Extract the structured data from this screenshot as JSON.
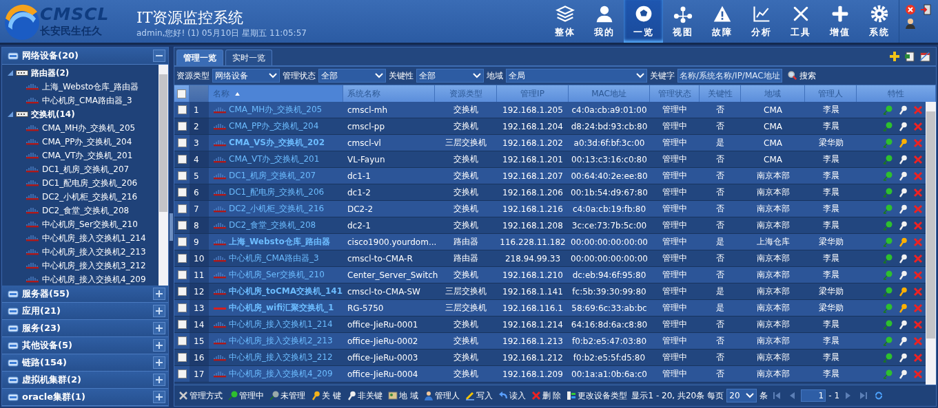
{
  "header": {
    "logo": {
      "name": "CMSCL",
      "slogan": "长安民生任久"
    },
    "title": "IT资源监控系统",
    "status_line": "admin,您好! (1) 05月10日 星期五 11:05:57",
    "nav": [
      {
        "label": "整体",
        "selected": false
      },
      {
        "label": "我的",
        "selected": false
      },
      {
        "label": "一览",
        "selected": true
      },
      {
        "label": "视图",
        "selected": false
      },
      {
        "label": "故障",
        "selected": false
      },
      {
        "label": "分析",
        "selected": false
      },
      {
        "label": "工具",
        "selected": false
      },
      {
        "label": "增值",
        "selected": false
      },
      {
        "label": "系统",
        "selected": false
      }
    ]
  },
  "sidebar": {
    "groups": [
      {
        "label": "网络设备(20)",
        "expanded": true,
        "children": [
          {
            "label": "路由器(2)",
            "expanded": true,
            "children": [
              {
                "label": "上海_Websto仓库_路由器"
              },
              {
                "label": "中心机房_CMA路由器_3"
              }
            ]
          },
          {
            "label": "交换机(14)",
            "expanded": true,
            "children": [
              {
                "label": "CMA_MH办_交换机_205"
              },
              {
                "label": "CMA_PP办_交换机_204"
              },
              {
                "label": "CMA_VT办_交换机_201"
              },
              {
                "label": "DC1_机房_交换机_207"
              },
              {
                "label": "DC1_配电房_交换机_206"
              },
              {
                "label": "DC2_小机柜_交换机_216"
              },
              {
                "label": "DC2_食堂_交换机_208"
              },
              {
                "label": "中心机房_Ser交换机_210"
              },
              {
                "label": "中心机房_接入交换机1_214"
              },
              {
                "label": "中心机房_接入交换机2_213"
              },
              {
                "label": "中心机房_接入交换机3_212"
              },
              {
                "label": "中心机房_接入交换机4_209"
              }
            ]
          }
        ]
      },
      {
        "label": "服务器(55)",
        "expanded": false
      },
      {
        "label": "应用(21)",
        "expanded": false
      },
      {
        "label": "服务(23)",
        "expanded": false
      },
      {
        "label": "其他设备(5)",
        "expanded": false
      },
      {
        "label": "链路(154)",
        "expanded": false
      },
      {
        "label": "虚拟机集群(2)",
        "expanded": false
      },
      {
        "label": "oracle集群(1)",
        "expanded": false
      }
    ]
  },
  "tabs": [
    {
      "label": "管理一览",
      "selected": true
    },
    {
      "label": "实时一览",
      "selected": false
    }
  ],
  "filters": [
    {
      "label": "资源类型",
      "value": "网络设备"
    },
    {
      "label": "管理状态",
      "value": "全部"
    },
    {
      "label": "关键性",
      "value": "全部"
    },
    {
      "label": "地域",
      "value": "全局"
    }
  ],
  "keyword": {
    "label": "关键字",
    "placeholder": "名称/系统名称/IP/MAC地址"
  },
  "search_button": "搜索",
  "table": {
    "select_all_checked": false,
    "columns": [
      {
        "label": "名称",
        "sorted": true
      },
      {
        "label": "系统名称",
        "sorted": false
      },
      {
        "label": "资源类型",
        "sorted": false
      },
      {
        "label": "管理IP",
        "sorted": false
      },
      {
        "label": "MAC地址",
        "sorted": false
      },
      {
        "label": "管理状态",
        "sorted": false
      },
      {
        "label": "关键性",
        "sorted": false
      },
      {
        "label": "地域",
        "sorted": false
      },
      {
        "label": "管理人",
        "sorted": false
      },
      {
        "label": "特性",
        "sorted": false
      }
    ],
    "rows": [
      {
        "checked": false,
        "index": "1",
        "kind": "cisco",
        "name": "CMA_MH办_交换机_205",
        "system_name": "cmscl-mh",
        "type": "交换机",
        "ip": "192.168.1.205",
        "mac": "c4:0a:cb:a9:01:00",
        "status": "管理中",
        "critical": "否",
        "region": "CMA",
        "manager": "李晨",
        "key": false
      },
      {
        "checked": false,
        "index": "2",
        "kind": "cisco",
        "name": "CMA_PP办_交换机_204",
        "system_name": "cmscl-pp",
        "type": "交换机",
        "ip": "192.168.1.204",
        "mac": "d8:24:bd:93:cb:80",
        "status": "管理中",
        "critical": "否",
        "region": "CMA",
        "manager": "李晨",
        "key": false
      },
      {
        "checked": false,
        "index": "3",
        "kind": "cisco",
        "name": "CMA_VS办_交换机_202",
        "system_name": "cmscl-vl",
        "type": "三层交换机",
        "ip": "192.168.1.202",
        "mac": "a0:3d:6f:bf:3c:00",
        "status": "管理中",
        "critical": "是",
        "region": "CMA",
        "manager": "梁华勋",
        "key": true
      },
      {
        "checked": false,
        "index": "4",
        "kind": "cisco",
        "name": "CMA_VT办_交换机_201",
        "system_name": "VL-Fayun",
        "type": "交换机",
        "ip": "192.168.1.201",
        "mac": "00:13:c3:16:c0:80",
        "status": "管理中",
        "critical": "否",
        "region": "CMA",
        "manager": "李晨",
        "key": false
      },
      {
        "checked": false,
        "index": "5",
        "kind": "cisco",
        "name": "DC1_机房_交换机_207",
        "system_name": "dc1-1",
        "type": "交换机",
        "ip": "192.168.1.207",
        "mac": "00:64:40:2e:ee:80",
        "status": "管理中",
        "critical": "否",
        "region": "南京本部",
        "manager": "李晨",
        "key": false
      },
      {
        "checked": false,
        "index": "6",
        "kind": "cisco",
        "name": "DC1_配电房_交换机_206",
        "system_name": "dc1-2",
        "type": "交换机",
        "ip": "192.168.1.206",
        "mac": "00:1b:54:d9:67:80",
        "status": "管理中",
        "critical": "否",
        "region": "南京本部",
        "manager": "李晨",
        "key": false
      },
      {
        "checked": false,
        "index": "7",
        "kind": "cisco",
        "name": "DC2_小机柜_交换机_216",
        "system_name": "DC2-2",
        "type": "交换机",
        "ip": "192.168.1.216",
        "mac": "c4:0a:cb:19:fb:80",
        "status": "管理中",
        "critical": "否",
        "region": "南京本部",
        "manager": "李晨",
        "key": false
      },
      {
        "checked": false,
        "index": "8",
        "kind": "cisco",
        "name": "DC2_食堂_交换机_208",
        "system_name": "dc2-1",
        "type": "交换机",
        "ip": "192.168.1.208",
        "mac": "3c:ce:73:7b:5c:00",
        "status": "管理中",
        "critical": "否",
        "region": "南京本部",
        "manager": "李晨",
        "key": false
      },
      {
        "checked": false,
        "index": "9",
        "kind": "cisco",
        "name": "上海_Websto仓库_路由器",
        "system_name": "cisco1900.yourdom...",
        "type": "路由器",
        "ip": "116.228.11.182",
        "mac": "00:00:00:00:00:00",
        "status": "管理中",
        "critical": "是",
        "region": "上海仓库",
        "manager": "梁华勋",
        "key": true
      },
      {
        "checked": false,
        "index": "10",
        "kind": "cisco",
        "name": "中心机房_CMA路由器_3",
        "system_name": "cmscl-to-CMA-R",
        "type": "路由器",
        "ip": "218.94.99.33",
        "mac": "00:00:00:00:00:00",
        "status": "管理中",
        "critical": "否",
        "region": "南京本部",
        "manager": "李晨",
        "key": false
      },
      {
        "checked": false,
        "index": "11",
        "kind": "cisco",
        "name": "中心机房_Ser交换机_210",
        "system_name": "Center_Server_Switch",
        "type": "交换机",
        "ip": "192.168.1.210",
        "mac": "dc:eb:94:6f:95:80",
        "status": "管理中",
        "critical": "否",
        "region": "南京本部",
        "manager": "李晨",
        "key": false
      },
      {
        "checked": false,
        "index": "12",
        "kind": "cisco",
        "name": "中心机房_toCMA交换机_141",
        "system_name": "cmscl-to-CMA-SW",
        "type": "三层交换机",
        "ip": "192.168.1.141",
        "mac": "fc:5b:39:30:99:80",
        "status": "管理中",
        "critical": "是",
        "region": "南京本部",
        "manager": "梁华勋",
        "key": true
      },
      {
        "checked": false,
        "index": "13",
        "kind": "ruijie",
        "name": "中心机房_wifi汇聚交换机_1",
        "system_name": "RG-5750",
        "type": "三层交换机",
        "ip": "192.168.116.1",
        "mac": "58:69:6c:33:ab:bc",
        "status": "管理中",
        "critical": "是",
        "region": "南京本部",
        "manager": "梁华勋",
        "key": true
      },
      {
        "checked": false,
        "index": "14",
        "kind": "cisco",
        "name": "中心机房_接入交换机1_214",
        "system_name": "office-JieRu-0001",
        "type": "交换机",
        "ip": "192.168.1.214",
        "mac": "64:16:8d:6a:c8:80",
        "status": "管理中",
        "critical": "否",
        "region": "南京本部",
        "manager": "李晨",
        "key": false
      },
      {
        "checked": false,
        "index": "15",
        "kind": "cisco",
        "name": "中心机房_接入交换机2_213",
        "system_name": "office-JieRu-0002",
        "type": "交换机",
        "ip": "192.168.1.213",
        "mac": "f0:b2:e5:47:03:80",
        "status": "管理中",
        "critical": "否",
        "region": "南京本部",
        "manager": "李晨",
        "key": false
      },
      {
        "checked": false,
        "index": "16",
        "kind": "cisco",
        "name": "中心机房_接入交换机3_212",
        "system_name": "office-JieRu-0003",
        "type": "交换机",
        "ip": "192.168.1.212",
        "mac": "f0:b2:e5:5f:d5:80",
        "status": "管理中",
        "critical": "否",
        "region": "南京本部",
        "manager": "李晨",
        "key": false
      },
      {
        "checked": false,
        "index": "17",
        "kind": "cisco",
        "name": "中心机房_接入交换机4_209",
        "system_name": "office-JieRu-0004",
        "type": "交换机",
        "ip": "192.168.1.209",
        "mac": "00:1a:a1:0b:6a:c0",
        "status": "管理中",
        "critical": "否",
        "region": "南京本部",
        "manager": "李晨",
        "key": false
      }
    ]
  },
  "footer": {
    "actions": [
      "管理方式",
      "管理中",
      "未管理",
      "关 键",
      "非关键",
      "地 域",
      "管理人",
      "写入",
      "读入",
      "删 除",
      "更改设备类型"
    ],
    "summary": "显示1 - 20, 共20条",
    "per_page_label": "每页",
    "per_page": "20",
    "per_page_unit": "条",
    "page": "1",
    "page_total": "- 1"
  }
}
